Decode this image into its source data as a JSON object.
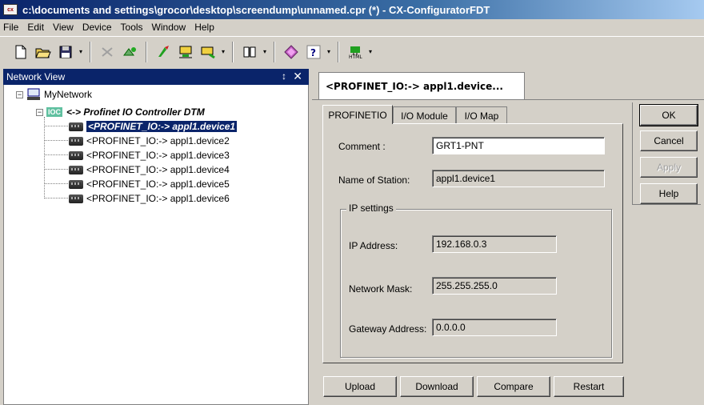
{
  "window": {
    "title": "c:\\documents and settings\\grocor\\desktop\\screendump\\unnamed.cpr (*)  - CX-ConfiguratorFDT",
    "app_icon_text": "cx"
  },
  "menu": [
    "File",
    "Edit",
    "View",
    "Device",
    "Tools",
    "Window",
    "Help"
  ],
  "toolbar": {
    "icons": [
      "new-icon",
      "open-icon",
      "save-icon",
      "cut-icon",
      "paste-icon",
      "connect-icon",
      "network-icon",
      "device-catalog-icon",
      "book-icon",
      "diamond-icon",
      "help-icon",
      "html-icon"
    ]
  },
  "network_view": {
    "title": "Network View",
    "pin": "↕",
    "close": "✕",
    "root": "MyNetwork",
    "controller_badge": "IOC",
    "controller": "<-> Profinet IO Controller DTM",
    "devices": [
      "<PROFINET_IO:-> appl1.device1",
      "<PROFINET_IO:-> appl1.device2",
      "<PROFINET_IO:-> appl1.device3",
      "<PROFINET_IO:-> appl1.device4",
      "<PROFINET_IO:-> appl1.device5",
      "<PROFINET_IO:-> appl1.device6"
    ],
    "selected_index": 0
  },
  "document_tab": "<PROFINET_IO:-> appl1.device...",
  "tabs": [
    "PROFINETIO",
    "I/O Module",
    "I/O Map"
  ],
  "form": {
    "comment_label": "Comment :",
    "comment_value": "GRT1-PNT",
    "station_label": "Name of Station:",
    "station_value": "appl1.device1",
    "ip_group_label": "IP settings",
    "ip_label": "IP Address:",
    "ip_value": "192.168.0.3",
    "mask_label": "Network Mask:",
    "mask_value": "255.255.255.0",
    "gateway_label": "Gateway Address:",
    "gateway_value": "0.0.0.0"
  },
  "side_buttons": {
    "ok": "OK",
    "cancel": "Cancel",
    "apply": "Apply",
    "help": "Help"
  },
  "bottom_buttons": {
    "upload": "Upload",
    "download": "Download",
    "compare": "Compare",
    "restart": "Restart"
  }
}
